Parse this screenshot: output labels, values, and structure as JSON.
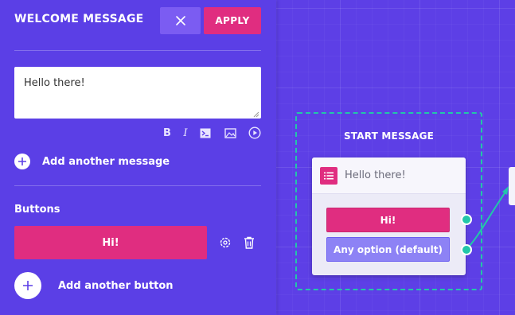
{
  "panel": {
    "title": "WELCOME MESSAGE",
    "close_icon": "close-icon",
    "apply_label": "APPLY",
    "message_value": "Hello there!",
    "format_toolbar": [
      {
        "name": "bold-icon",
        "glyph": "B"
      },
      {
        "name": "italic-icon",
        "glyph": "I"
      },
      {
        "name": "code-icon",
        "glyph": ">_"
      },
      {
        "name": "image-icon",
        "glyph": "image"
      },
      {
        "name": "play-icon",
        "glyph": "play"
      }
    ],
    "add_message_label": "Add another message",
    "buttons_section_label": "Buttons",
    "buttons": [
      {
        "label": "Hi!"
      }
    ],
    "add_button_label": "Add another button"
  },
  "canvas": {
    "start_title": "START MESSAGE",
    "node": {
      "text": "Hello there!",
      "buttons": [
        {
          "label": "Hi!"
        },
        {
          "label": "Any option (default)"
        }
      ]
    }
  },
  "colors": {
    "panel_bg": "#5b3fe6",
    "accent_pink": "#e02d80",
    "secondary_purple": "#7b5cf2",
    "connector_green": "#22c7a9",
    "default_option": "#8d82f5"
  }
}
